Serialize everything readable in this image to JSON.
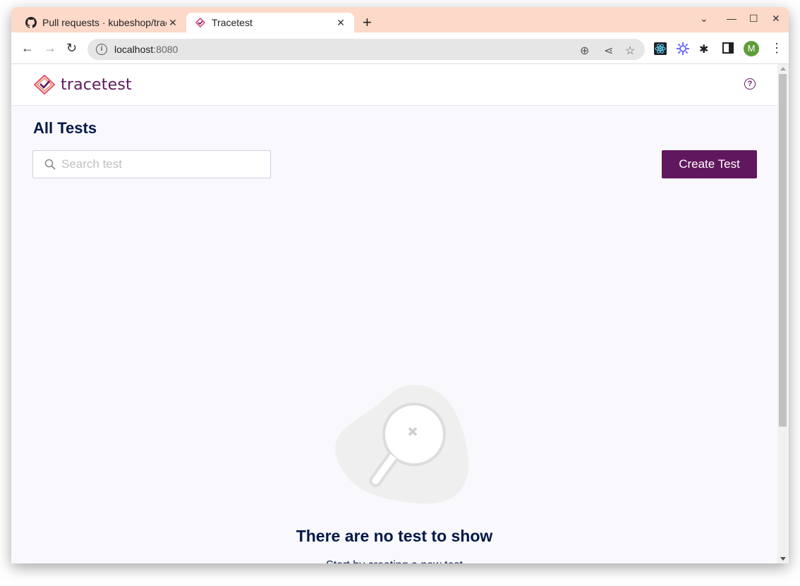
{
  "browser": {
    "tabs": [
      {
        "title": "Pull requests · kubeshop/tracetest",
        "icon": "github-icon",
        "active": false
      },
      {
        "title": "Tracetest",
        "icon": "tracetest-favicon",
        "active": true
      }
    ],
    "new_tab_label": "+",
    "url_host": "localhost",
    "url_port": ":8080",
    "profile_initial": "M",
    "colors": {
      "tabstrip": "#fcd9c8",
      "profile": "#5f9c3a"
    }
  },
  "app": {
    "brand": "tracetest",
    "help_label": "?",
    "page_title": "All Tests",
    "search": {
      "placeholder": "Search test",
      "value": ""
    },
    "create_button": "Create Test",
    "empty_state": {
      "title": "There are no test to show",
      "subtitle": "Start by creating a new test"
    },
    "colors": {
      "primary": "#61175e",
      "heading": "#031849",
      "background": "#f9f9fd"
    }
  }
}
